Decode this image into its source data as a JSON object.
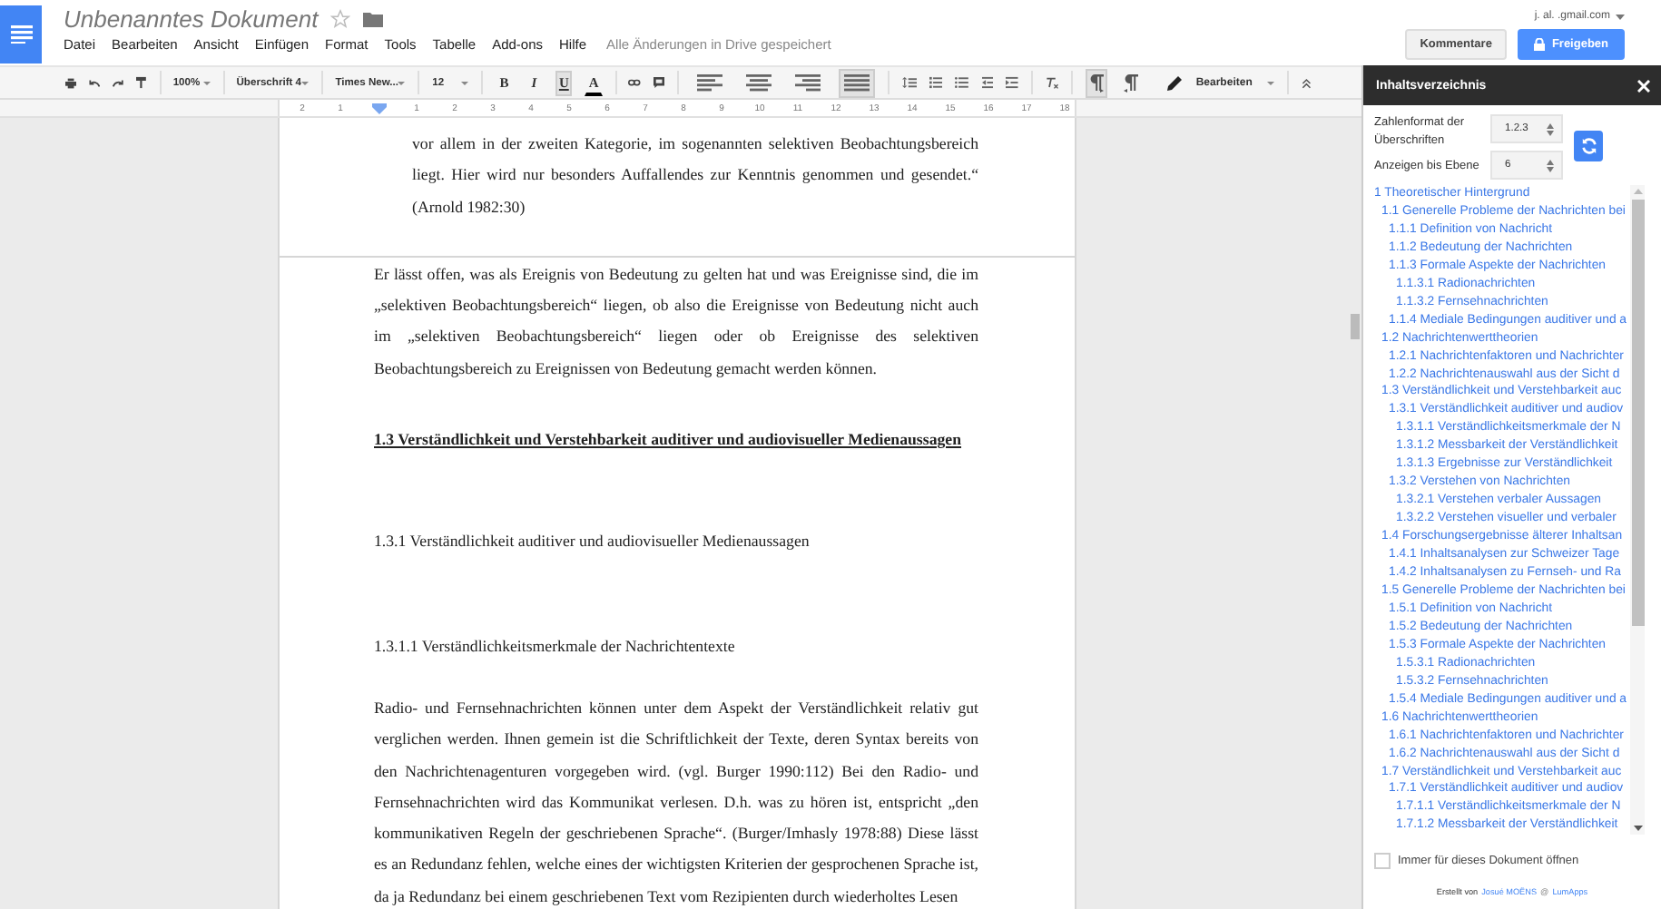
{
  "header": {
    "title": "Unbenanntes Dokument",
    "starred": false,
    "menu": [
      "Datei",
      "Bearbeiten",
      "Ansicht",
      "Einfügen",
      "Format",
      "Tools",
      "Tabelle",
      "Add-ons",
      "Hilfe"
    ],
    "save_status": "Alle Änderungen in Drive gespeichert",
    "account": "j.  al.  .gmail.com",
    "comments_button": "Kommentare",
    "share_button": "Freigeben"
  },
  "toolbar": {
    "zoom": "100%",
    "style": "Überschrift 4",
    "font": "Times New...",
    "size": "12",
    "format_buttons": [
      {
        "kind": "bold",
        "label": "B",
        "selected": false
      },
      {
        "kind": "italic",
        "label": "I",
        "selected": false
      },
      {
        "kind": "underline",
        "label": "U",
        "selected": true
      },
      {
        "kind": "color",
        "label": "A",
        "selected": false
      }
    ],
    "align_buttons": [
      {
        "kind": "left",
        "selected": false
      },
      {
        "kind": "center",
        "selected": false
      },
      {
        "kind": "right",
        "selected": false
      },
      {
        "kind": "justify",
        "selected": true
      }
    ],
    "direction_buttons": [
      {
        "kind": "ltr",
        "selected": true
      },
      {
        "kind": "rtl",
        "selected": false
      }
    ],
    "mode": "Bearbeiten"
  },
  "ruler": {
    "before": [
      "2",
      "1"
    ],
    "after": [
      "1",
      "2",
      "3",
      "4",
      "5",
      "6",
      "7",
      "8",
      "9",
      "10",
      "11",
      "12",
      "13",
      "14",
      "15",
      "16",
      "17",
      "18"
    ]
  },
  "document": {
    "blocks": [
      {
        "kind": "quote",
        "text": "vor allem in der zweiten Kategorie, im sogenannten selektiven Beobachtungsbereich liegt. Hier wird nur besonders Auffallendes zur Kenntnis genommen und gesendet.“ (Arnold 1982:30)"
      },
      {
        "kind": "page_break"
      },
      {
        "kind": "paragraph",
        "text": "Er lässt offen, was als Ereignis von Bedeutung zu gelten hat und was Ereignisse sind, die im „selektiven Beobachtungsbereich“ liegen, ob also die Ereignisse von Bedeutung nicht auch im „selektiven Beobachtungsbereich“ liegen oder ob Ereignisse des selektiven Beobachtungsbereich zu Ereignissen von Bedeutung gemacht werden können."
      },
      {
        "kind": "heading2",
        "text": "1.3 Verständlichkeit und Verstehbarkeit auditiver und audiovisueller Medienaussagen"
      },
      {
        "kind": "heading3",
        "text": "1.3.1 Verständlichkeit auditiver und audiovisueller Medienaussagen"
      },
      {
        "kind": "heading4",
        "text": "1.3.1.1 Verständlichkeitsmerkmale der Nachrichtentexte"
      },
      {
        "kind": "paragraph",
        "text": "Radio- und Fernsehnachrichten können unter dem Aspekt der Verständlichkeit relativ gut verglichen werden. Ihnen gemein ist die Schriftlichkeit der Texte, deren Syntax bereits von den Nachrichtenagenturen vorgegeben wird. (vgl. Burger 1990:112) Bei den Radio- und Fernsehnachrichten wird das Kommunikat verlesen. D.h. was zu hören ist, entspricht „den kommunikativen Regeln der geschriebenen Sprache“. (Burger/Imhasly 1978:88) Diese lässt es an Redundanz fehlen, welche eines der wichtigsten Kriterien der gesprochenen Sprache ist, da ja Redundanz bei einem geschriebenen Text vom Rezipienten durch wiederholtes Lesen"
      }
    ]
  },
  "sidebar": {
    "title": "Inhaltsverzeichnis",
    "number_format_label": "Zahlenformat der Überschriften",
    "number_format": "1.2.3",
    "level_label": "Anzeigen bis Ebene",
    "level": "6",
    "toc": [
      {
        "label": "1 Theoretischer Hintergrund",
        "children": [
          {
            "label": "1.1 Generelle Probleme der Nachrichten bei",
            "children": [
              {
                "label": "1.1.1 Definition von Nachricht"
              },
              {
                "label": "1.1.2 Bedeutung der Nachrichten"
              },
              {
                "label": "1.1.3 Formale Aspekte der Nachrichten",
                "children": [
                  {
                    "label": "1.1.3.1 Radionachrichten"
                  },
                  {
                    "label": "1.1.3.2 Fernsehnachrichten"
                  }
                ]
              },
              {
                "label": "1.1.4 Mediale Bedingungen auditiver und a"
              }
            ]
          },
          {
            "label": "1.2 Nachrichtenwerttheorien",
            "children": [
              {
                "label": "1.2.1 Nachrichtenfaktoren und Nachrichter"
              },
              {
                "label": "1.2.2 Nachrichtenauswahl aus der Sicht d"
              }
            ]
          },
          {
            "label": "1.3 Verständlichkeit und Verstehbarkeit auc",
            "children": [
              {
                "label": "1.3.1 Verständlichkeit auditiver und audiov",
                "children": [
                  {
                    "label": "1.3.1.1 Verständlichkeitsmerkmale der N"
                  },
                  {
                    "label": "1.3.1.2 Messbarkeit der Verständlichkeit"
                  },
                  {
                    "label": "1.3.1.3 Ergebnisse zur Verständlichkeit"
                  }
                ]
              },
              {
                "label": "1.3.2 Verstehen von Nachrichten",
                "children": [
                  {
                    "label": "1.3.2.1 Verstehen verbaler Aussagen"
                  },
                  {
                    "label": "1.3.2.2 Verstehen visueller und verbaler"
                  }
                ]
              }
            ]
          },
          {
            "label": "1.4 Forschungsergebnisse älterer Inhaltsan",
            "children": [
              {
                "label": "1.4.1 Inhaltsanalysen zur Schweizer Tage"
              },
              {
                "label": "1.4.2 Inhaltsanalysen zu Fernseh- und Ra"
              }
            ]
          },
          {
            "label": "1.5 Generelle Probleme der Nachrichten bei",
            "children": [
              {
                "label": "1.5.1 Definition von Nachricht"
              },
              {
                "label": "1.5.2 Bedeutung der Nachrichten"
              },
              {
                "label": "1.5.3 Formale Aspekte der Nachrichten",
                "children": [
                  {
                    "label": "1.5.3.1 Radionachrichten"
                  },
                  {
                    "label": "1.5.3.2 Fernsehnachrichten"
                  }
                ]
              },
              {
                "label": "1.5.4 Mediale Bedingungen auditiver und a"
              }
            ]
          },
          {
            "label": "1.6 Nachrichtenwerttheorien",
            "children": [
              {
                "label": "1.6.1 Nachrichtenfaktoren und Nachrichter"
              },
              {
                "label": "1.6.2 Nachrichtenauswahl aus der Sicht d"
              }
            ]
          },
          {
            "label": "1.7 Verständlichkeit und Verstehbarkeit auc",
            "children": [
              {
                "label": "1.7.1 Verständlichkeit auditiver und audiov",
                "children": [
                  {
                    "label": "1.7.1.1 Verständlichkeitsmerkmale der N"
                  },
                  {
                    "label": "1.7.1.2 Messbarkeit der Verständlichkeit"
                  }
                ]
              }
            ]
          }
        ]
      }
    ],
    "always_open_label": "Immer für dieses Dokument öffnen",
    "always_open_checked": false,
    "credit": {
      "prefix": "Erstellt von",
      "author": "Josué MOËNS",
      "separator": "@",
      "company": "LumApps"
    }
  }
}
